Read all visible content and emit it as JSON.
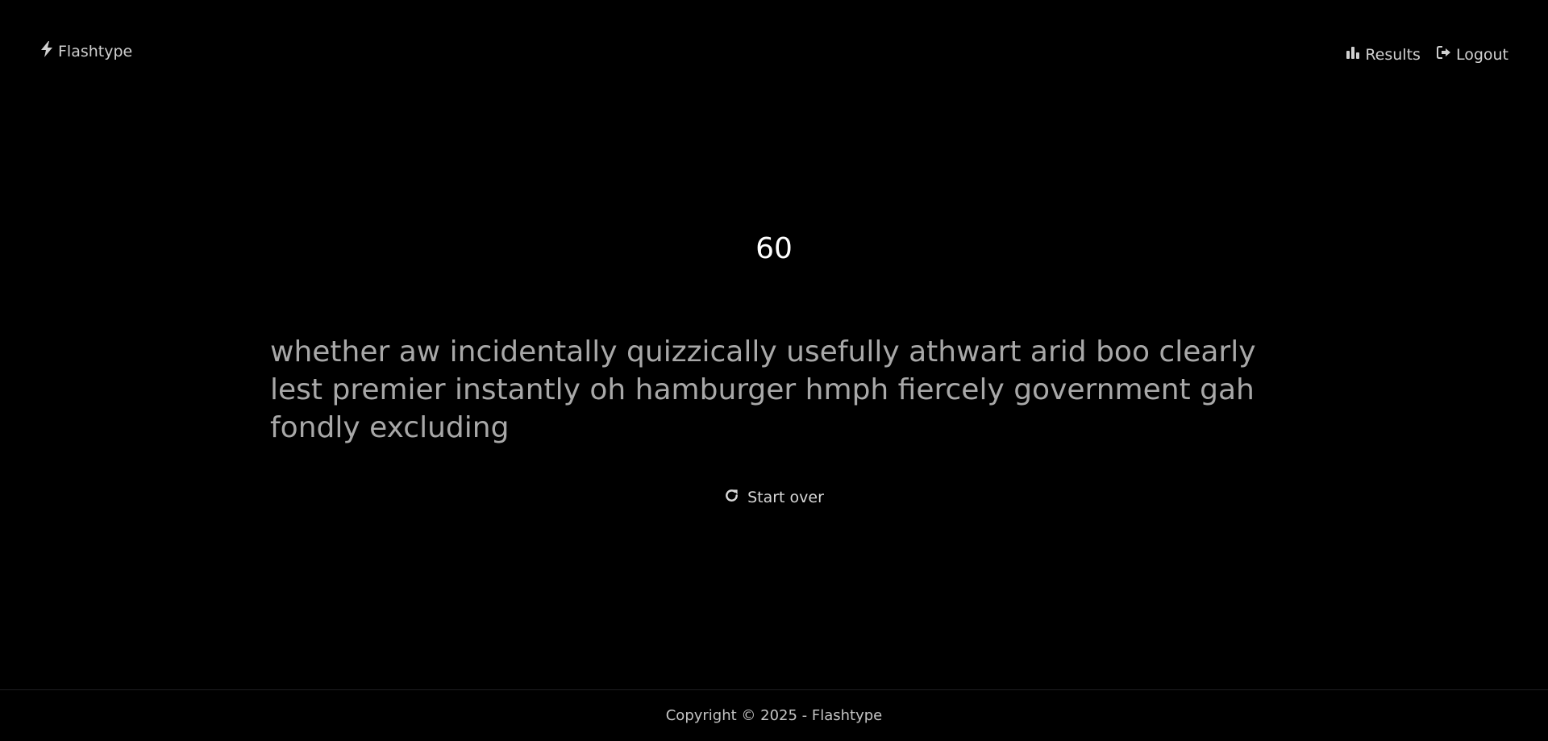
{
  "header": {
    "brand_icon": "bolt-icon",
    "brand_label": "Flashtype",
    "nav": [
      {
        "icon": "bar-chart-icon",
        "label": "Results"
      },
      {
        "icon": "logout-icon",
        "label": "Logout"
      }
    ]
  },
  "test": {
    "timer": "60",
    "words": "whether aw incidentally quizzically usefully athwart arid boo clearly lest premier instantly oh hamburger hmph fiercely government gah fondly excluding"
  },
  "controls": {
    "start_over_icon": "refresh-icon",
    "start_over_label": "Start over"
  },
  "footer": {
    "copyright": "Copyright © 2025 - Flashtype"
  },
  "colors": {
    "background": "#000000",
    "text_primary": "#ffffff",
    "text_muted": "#a8a8a8",
    "nav_text": "#d0d0d0"
  }
}
